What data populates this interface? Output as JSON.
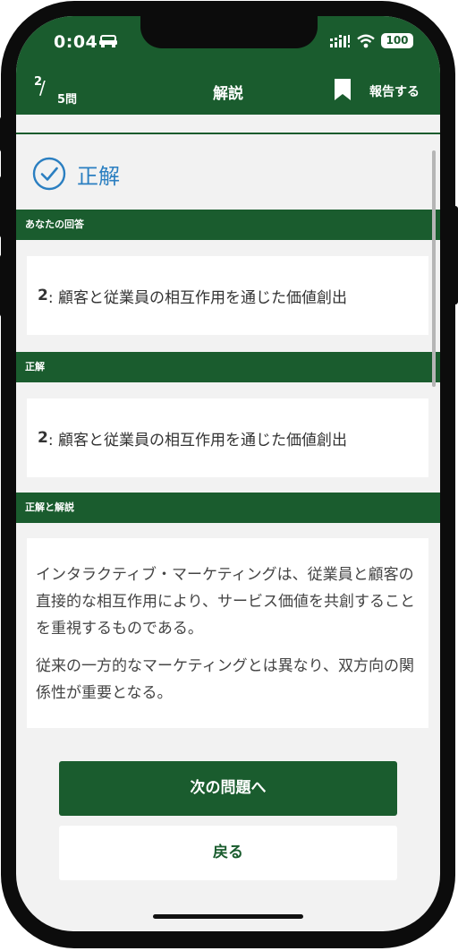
{
  "status_bar": {
    "time": "0:04",
    "battery": "100"
  },
  "header": {
    "counter_current": "2",
    "counter_total": "5問",
    "title": "解説",
    "report_label": "報告する"
  },
  "result": {
    "label": "正解"
  },
  "sections": {
    "your_answer": {
      "heading": "あなたの回答",
      "number": "2",
      "text": ": 顧客と従業員の相互作用を通じた価値創出"
    },
    "correct_answer": {
      "heading": "正解",
      "number": "2",
      "text": ": 顧客と従業員の相互作用を通じた価値創出"
    },
    "explanation": {
      "heading": "正解と解説",
      "paragraphs": [
        "インタラクティブ・マーケティングは、従業員と顧客の直接的な相互作用により、サービス価値を共創することを重視するものである。",
        "従来の一方的なマーケティングとは異なり、双方向の関係性が重要となる。"
      ]
    }
  },
  "buttons": {
    "next": "次の問題へ",
    "back": "戻る"
  },
  "colors": {
    "brand_green": "#1a5c2e",
    "correct_blue": "#2b7fc1",
    "background": "#f2f2f2"
  },
  "icons": [
    "car-icon",
    "signal-icon",
    "wifi-icon",
    "battery-icon",
    "bookmark-icon",
    "check-circle-icon"
  ]
}
